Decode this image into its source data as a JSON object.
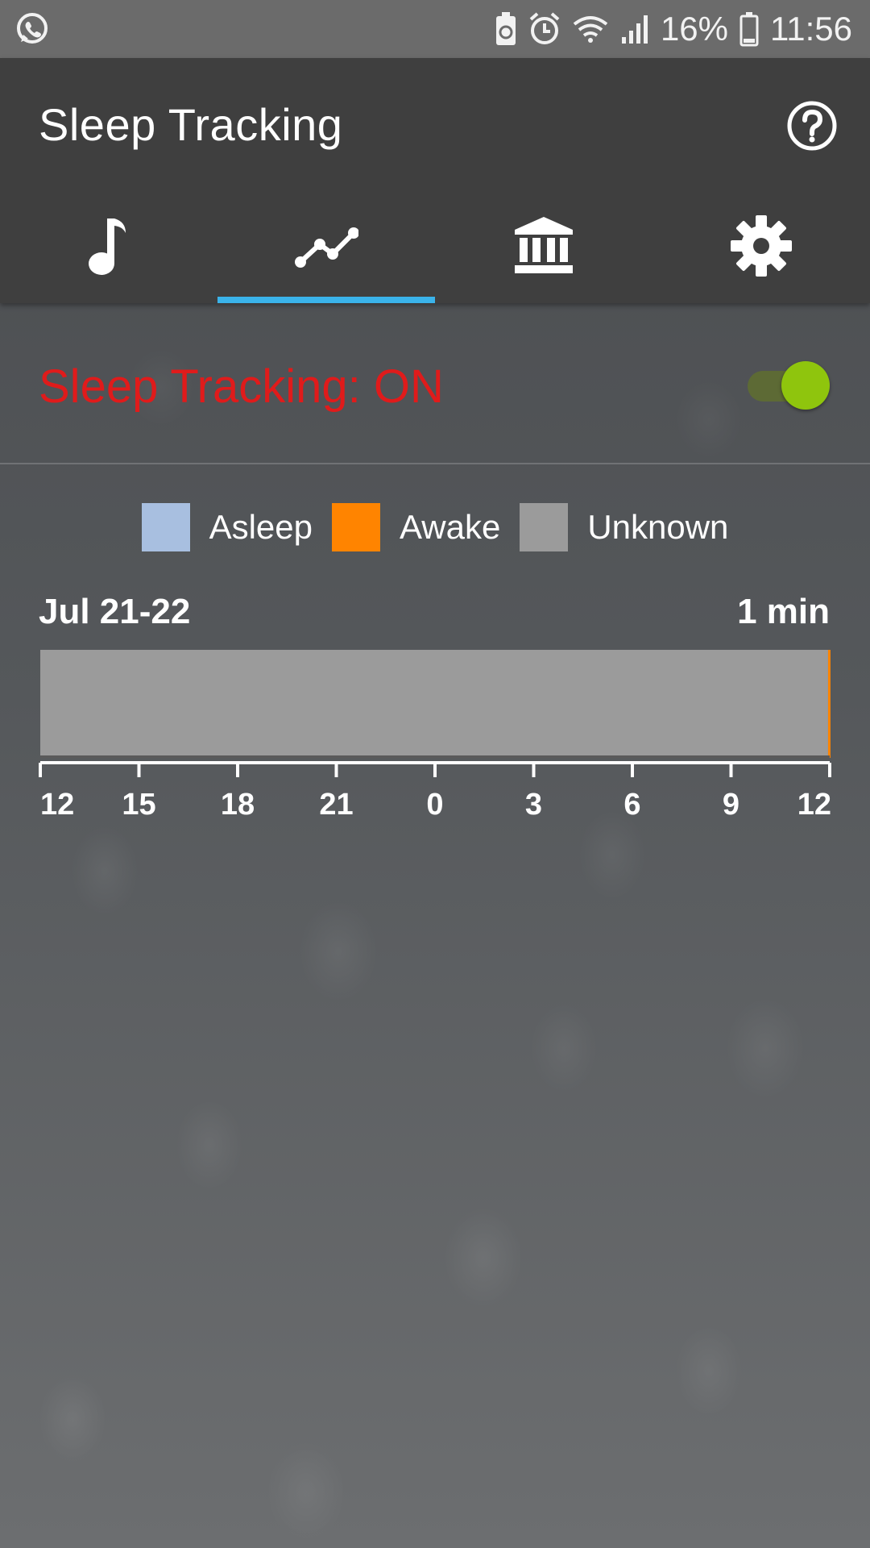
{
  "status_bar": {
    "battery_percent": "16%",
    "time": "11:56",
    "left_icon": "whatsapp-icon",
    "right_icons": [
      "battery-saver-icon",
      "alarm-icon",
      "wifi-icon",
      "signal-icon",
      "battery-icon"
    ]
  },
  "app_bar": {
    "title": "Sleep Tracking",
    "help_icon": "help-icon",
    "tabs": [
      {
        "icon": "music-note-icon",
        "active": false
      },
      {
        "icon": "chart-line-icon",
        "active": true
      },
      {
        "icon": "bank-icon",
        "active": false
      },
      {
        "icon": "gear-icon",
        "active": false
      }
    ],
    "accent_color": "#3ab3ea"
  },
  "tracking": {
    "status_text": "Sleep Tracking: ON",
    "toggle_on": true,
    "status_color": "#e01b1b",
    "toggle_color": "#8fc50d"
  },
  "legend": [
    {
      "label": "Asleep",
      "color": "#a8bfe0"
    },
    {
      "label": "Awake",
      "color": "#ff8400"
    },
    {
      "label": "Unknown",
      "color": "#9b9b9b"
    }
  ],
  "chart_data": {
    "type": "bar",
    "title": "Jul 21-22",
    "total_label": "1 min",
    "x_ticks": [
      "12",
      "15",
      "18",
      "21",
      "0",
      "3",
      "6",
      "9",
      "12"
    ],
    "x_range_hours": [
      12,
      36
    ],
    "segments": [
      {
        "state": "Unknown",
        "start_hour": 12,
        "end_hour": 35.95
      },
      {
        "state": "Awake",
        "start_hour": 35.95,
        "end_hour": 36
      }
    ]
  }
}
